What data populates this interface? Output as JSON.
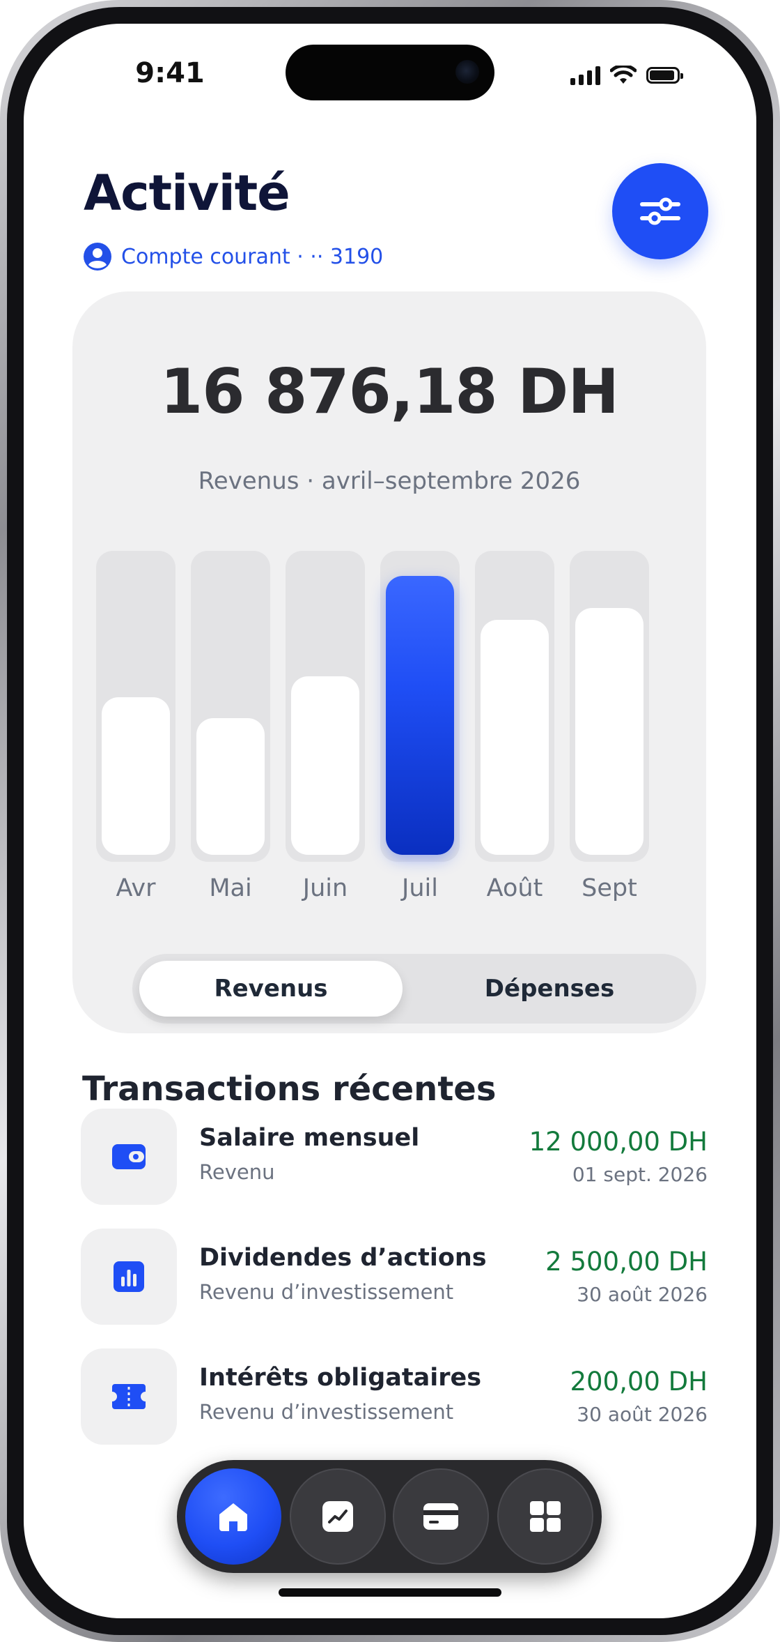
{
  "status_bar": {
    "time": "9:41"
  },
  "header": {
    "title": "Activité",
    "account": "Compte courant · ·· 3190"
  },
  "summary": {
    "amount": "16 876,18 DH",
    "subtitle": "Revenus · avril–septembre 2026"
  },
  "chart_data": {
    "type": "bar",
    "categories": [
      "Avr",
      "Mai",
      "Juin",
      "Juil",
      "Août",
      "Sept"
    ],
    "values": [
      0.53,
      0.46,
      0.6,
      0.94,
      0.79,
      0.83
    ],
    "highlighted": "Juil",
    "accent_color": "#1f4ef5"
  },
  "toggle": {
    "active": "Revenus",
    "inactive": "Dépenses"
  },
  "transactions": {
    "title": "Transactions récentes",
    "items": [
      {
        "name": "Salaire mensuel",
        "category": "Revenu",
        "amount": "12 000,00 DH",
        "date": "01 sept. 2026",
        "icon": "wallet-icon"
      },
      {
        "name": "Dividendes d’actions",
        "category": "Revenu d’investissement",
        "amount": "2 500,00 DH",
        "date": "30 août 2026",
        "icon": "bar-chart-icon"
      },
      {
        "name": "Intérêts obligataires",
        "category": "Revenu d’investissement",
        "amount": "200,00 DH",
        "date": "30 août 2026",
        "icon": "ticket-icon"
      }
    ]
  },
  "nav": {
    "items": [
      {
        "icon": "home-icon",
        "active": true
      },
      {
        "icon": "trend-icon",
        "active": false
      },
      {
        "icon": "card-icon",
        "active": false
      },
      {
        "icon": "grid-icon",
        "active": false
      }
    ]
  },
  "colors": {
    "accent": "#1f4ef5",
    "positive": "#137a3c",
    "title": "#0f1538"
  }
}
